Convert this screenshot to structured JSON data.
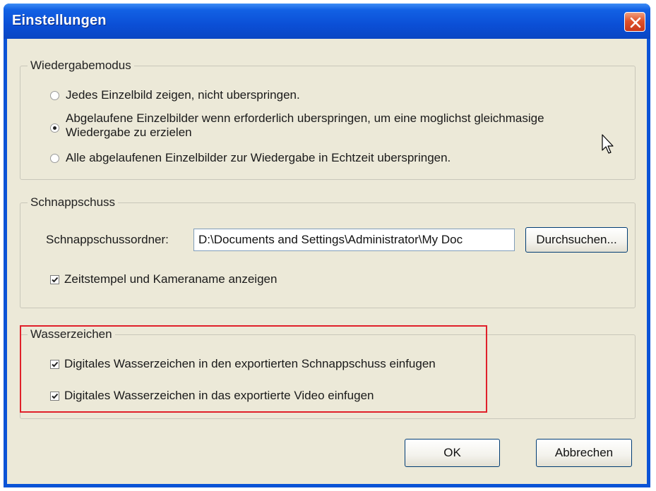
{
  "window": {
    "title": "Einstellungen",
    "close_icon": "close-icon"
  },
  "playback": {
    "legend": "Wiedergabemodus",
    "options": [
      {
        "label": "Jedes Einzelbild zeigen, nicht uberspringen.",
        "selected": false
      },
      {
        "label_line1": "Abgelaufene Einzelbilder wenn erforderlich uberspringen, um eine moglichst gleichmasige",
        "label_line2": "Wiedergabe zu erzielen",
        "selected": true
      },
      {
        "label": "Alle abgelaufenen Einzelbilder zur Wiedergabe in Echtzeit uberspringen.",
        "selected": false
      }
    ]
  },
  "snapshot": {
    "legend": "Schnappschuss",
    "folder_label": "Schnappschussordner:",
    "folder_value": "D:\\Documents and Settings\\Administrator\\My Doc",
    "browse_label": "Durchsuchen...",
    "timestamp_label": "Zeitstempel und Kameraname anzeigen",
    "timestamp_checked": true
  },
  "watermark": {
    "legend": "Wasserzeichen",
    "snapshot_label": "Digitales Wasserzeichen in den exportierten Schnappschuss einfugen",
    "snapshot_checked": true,
    "video_label": "Digitales Wasserzeichen in das exportierte Video einfugen",
    "video_checked": true
  },
  "buttons": {
    "ok": "OK",
    "cancel": "Abbrechen"
  },
  "colors": {
    "highlight": "#e0202a",
    "titlebar": "#0b53d6",
    "client": "#ece9d8"
  }
}
